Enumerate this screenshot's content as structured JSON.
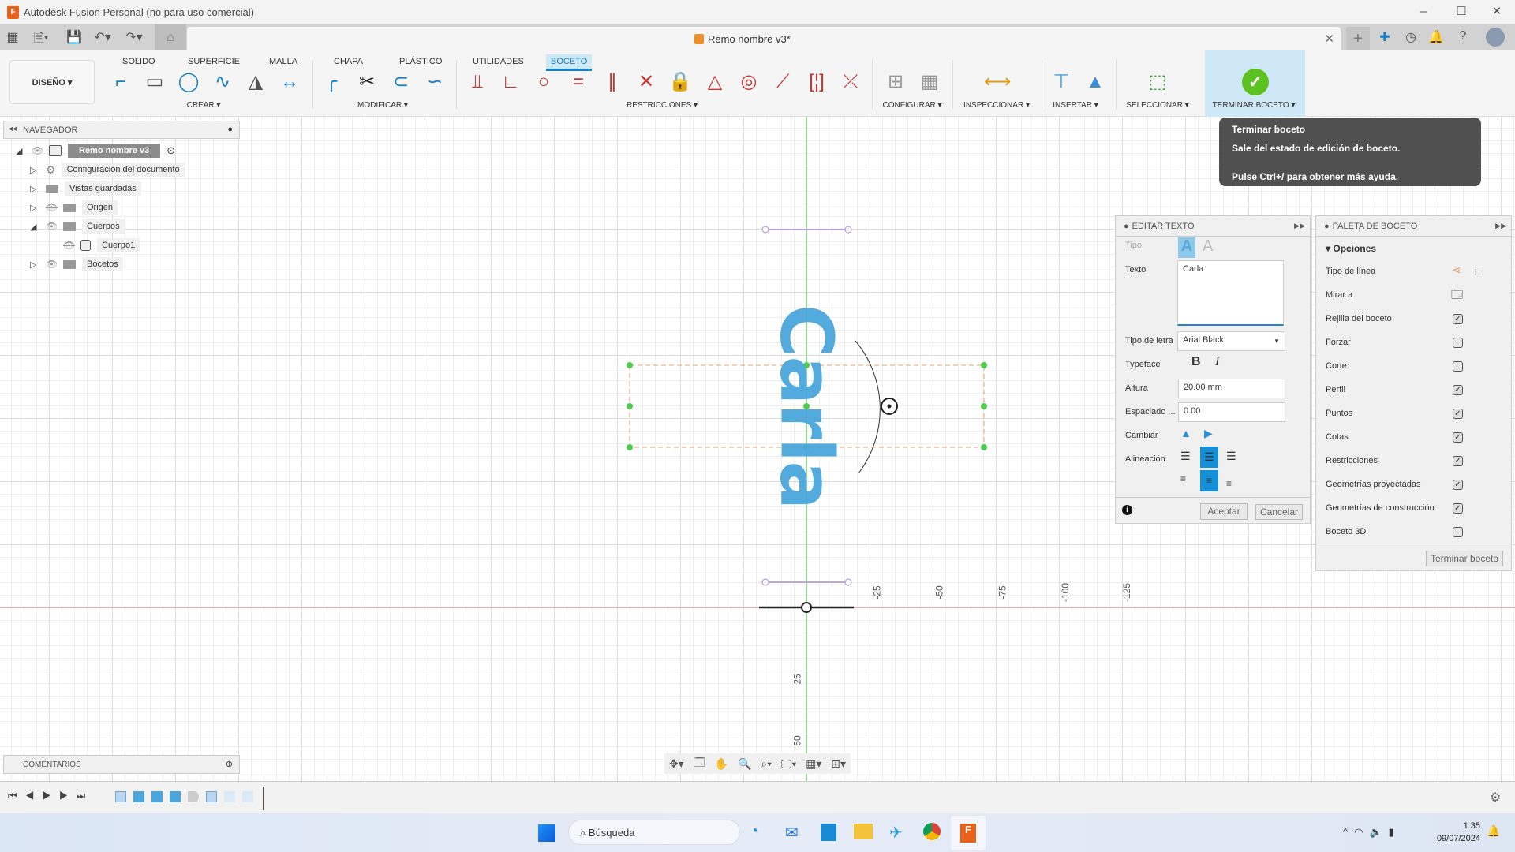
{
  "window": {
    "title": "Autodesk Fusion Personal (no para uso comercial)",
    "controls": [
      "–",
      "☐",
      "✕"
    ]
  },
  "document": {
    "title": "Remo nombre v3*"
  },
  "ribbon": {
    "workspace": "DISEÑO ▾",
    "tabs": [
      "SOLIDO",
      "SUPERFICIE",
      "MALLA",
      "CHAPA",
      "PLÁSTICO",
      "UTILIDADES",
      "BOCETO"
    ],
    "active_tab": "BOCETO",
    "groups": [
      "CREAR ▾",
      "MODIFICAR ▾",
      "RESTRICCIONES ▾",
      "CONFIGURAR ▾",
      "INSPECCIONAR ▾",
      "INSERTAR ▾",
      "SELECCIONAR ▾",
      "TERMINAR BOCETO ▾"
    ]
  },
  "tooltip": {
    "title": "Terminar boceto",
    "description": "Sale del estado de edición de boceto.",
    "hint": "Pulse Ctrl+/ para obtener más ayuda."
  },
  "navigator": {
    "title": "NAVEGADOR",
    "root": "Remo nombre v3",
    "items": [
      {
        "label": "Configuración del documento",
        "icon": "gear-icon",
        "visible": null
      },
      {
        "label": "Vistas guardadas",
        "icon": "folder-icon",
        "visible": null
      },
      {
        "label": "Origen",
        "icon": "folder-icon",
        "visible": false
      },
      {
        "label": "Cuerpos",
        "icon": "folder-icon",
        "visible": true,
        "expanded": true
      },
      {
        "label": "Cuerpo1",
        "icon": "body-icon",
        "visible": false,
        "child": true
      },
      {
        "label": "Bocetos",
        "icon": "folder-icon",
        "visible": true
      }
    ]
  },
  "comments": {
    "title": "COMENTARIOS"
  },
  "sketch": {
    "text": "Carla",
    "text_color": "#4aa6dc",
    "axis_labels_x": [
      "-25",
      "-50",
      "-75",
      "-100",
      "-125"
    ],
    "axis_labels_y": [
      "25",
      "50"
    ]
  },
  "edit_text": {
    "title": "EDITAR TEXTO",
    "type_label": "Tipo",
    "text_label": "Texto",
    "text_value": "Carla",
    "font_label": "Tipo de letra",
    "font_value": "Arial Black",
    "typeface_label": "Typeface",
    "bold": "B",
    "italic": "I",
    "height_label": "Altura",
    "height_value": "20.00 mm",
    "spacing_label": "Espaciado ...",
    "spacing_value": "0.00",
    "flip_label": "Cambiar",
    "align_label": "Alineación",
    "ok": "Aceptar",
    "cancel": "Cancelar"
  },
  "palette": {
    "title": "PALETA DE BOCETO",
    "section": "Opciones",
    "linetype_label": "Tipo de línea",
    "look_label": "Mirar a",
    "options": [
      {
        "label": "Rejilla del boceto",
        "checked": true
      },
      {
        "label": "Forzar",
        "checked": false
      },
      {
        "label": "Corte",
        "checked": false
      },
      {
        "label": "Perfil",
        "checked": true
      },
      {
        "label": "Puntos",
        "checked": true
      },
      {
        "label": "Cotas",
        "checked": true
      },
      {
        "label": "Restricciones",
        "checked": true
      },
      {
        "label": "Geometrías proyectadas",
        "checked": true
      },
      {
        "label": "Geometrías de construcción",
        "checked": true
      },
      {
        "label": "Boceto 3D",
        "checked": false
      }
    ],
    "finish": "Terminar boceto"
  },
  "taskbar": {
    "search_placeholder": "Búsqueda",
    "time": "1:35",
    "date": "09/07/2024"
  },
  "colors": {
    "accent": "#1a7ec2",
    "x_axis": "#d88a9a",
    "y_axis": "#7bd67b",
    "finish_green": "#5cc21f"
  }
}
